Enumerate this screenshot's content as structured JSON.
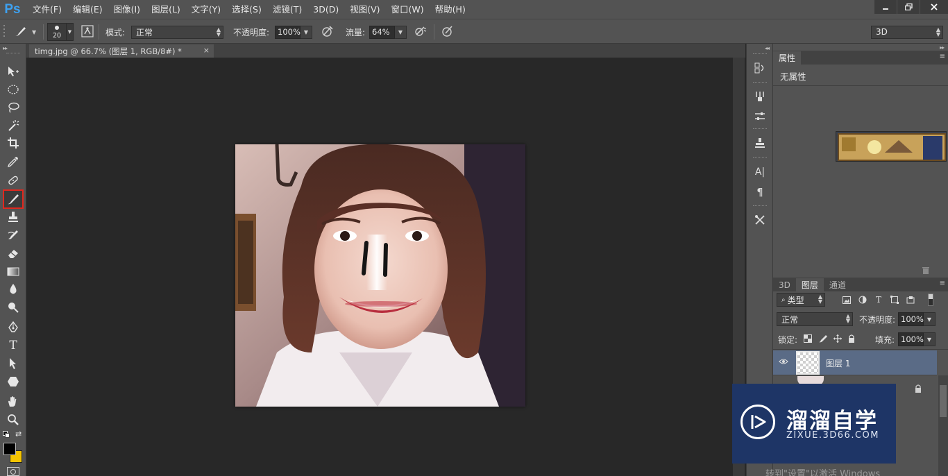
{
  "app": {
    "logo": "Ps",
    "menus": [
      "文件(F)",
      "编辑(E)",
      "图像(I)",
      "图层(L)",
      "文字(Y)",
      "选择(S)",
      "滤镜(T)",
      "3D(D)",
      "视图(V)",
      "窗口(W)",
      "帮助(H)"
    ],
    "window_controls": [
      "minimize-icon",
      "restore-icon",
      "close-icon"
    ]
  },
  "options": {
    "brush_size": "20",
    "mode_label": "模式:",
    "mode_value": "正常",
    "opacity_label": "不透明度:",
    "opacity_value": "100%",
    "flow_label": "流量:",
    "flow_value": "64%",
    "workspace_value": "3D"
  },
  "document": {
    "tab_title": "timg.jpg @ 66.7% (图层 1, RGB/8#) *",
    "close_glyph": "×"
  },
  "toolbox": {
    "active_tool": "brush-tool",
    "tools": [
      "move-tool",
      "marquee-tool",
      "lasso-tool",
      "magic-wand-tool",
      "crop-tool",
      "eyedropper-tool",
      "healing-tool",
      "brush-tool",
      "stamp-tool",
      "history-brush-tool",
      "eraser-tool",
      "gradient-tool",
      "blur-tool",
      "dodge-tool",
      "pen-tool",
      "type-tool",
      "path-select-tool",
      "shape-tool",
      "hand-tool",
      "zoom-tool"
    ],
    "foreground_color": "#000000",
    "background_color": "#f5c400"
  },
  "properties_panel": {
    "tab": "属性",
    "empty_text": "无属性"
  },
  "layers_panel": {
    "tabs": [
      "3D",
      "图层",
      "通道"
    ],
    "active_tab": "图层",
    "filter_label": "类型",
    "blend_mode": "正常",
    "opacity_label": "不透明度:",
    "opacity_value": "100%",
    "lock_label": "锁定:",
    "fill_label": "填充:",
    "fill_value": "100%",
    "layers": [
      {
        "name": "图层 1",
        "selected": true,
        "visible": true
      },
      {
        "name": "",
        "selected": false,
        "visible": true,
        "locked": true
      }
    ]
  },
  "watermark": {
    "brand_cn": "溜溜自学",
    "brand_url": "ZIXUE.3D66.COM"
  },
  "activation": {
    "text": "转到\"设置\"以激活 Windows"
  },
  "colors": {
    "accent_blue": "#3ea1f0",
    "active_tool_outline": "#e0281e",
    "selected_layer": "#5a6b86",
    "watermark_bg": "#1e3566"
  }
}
